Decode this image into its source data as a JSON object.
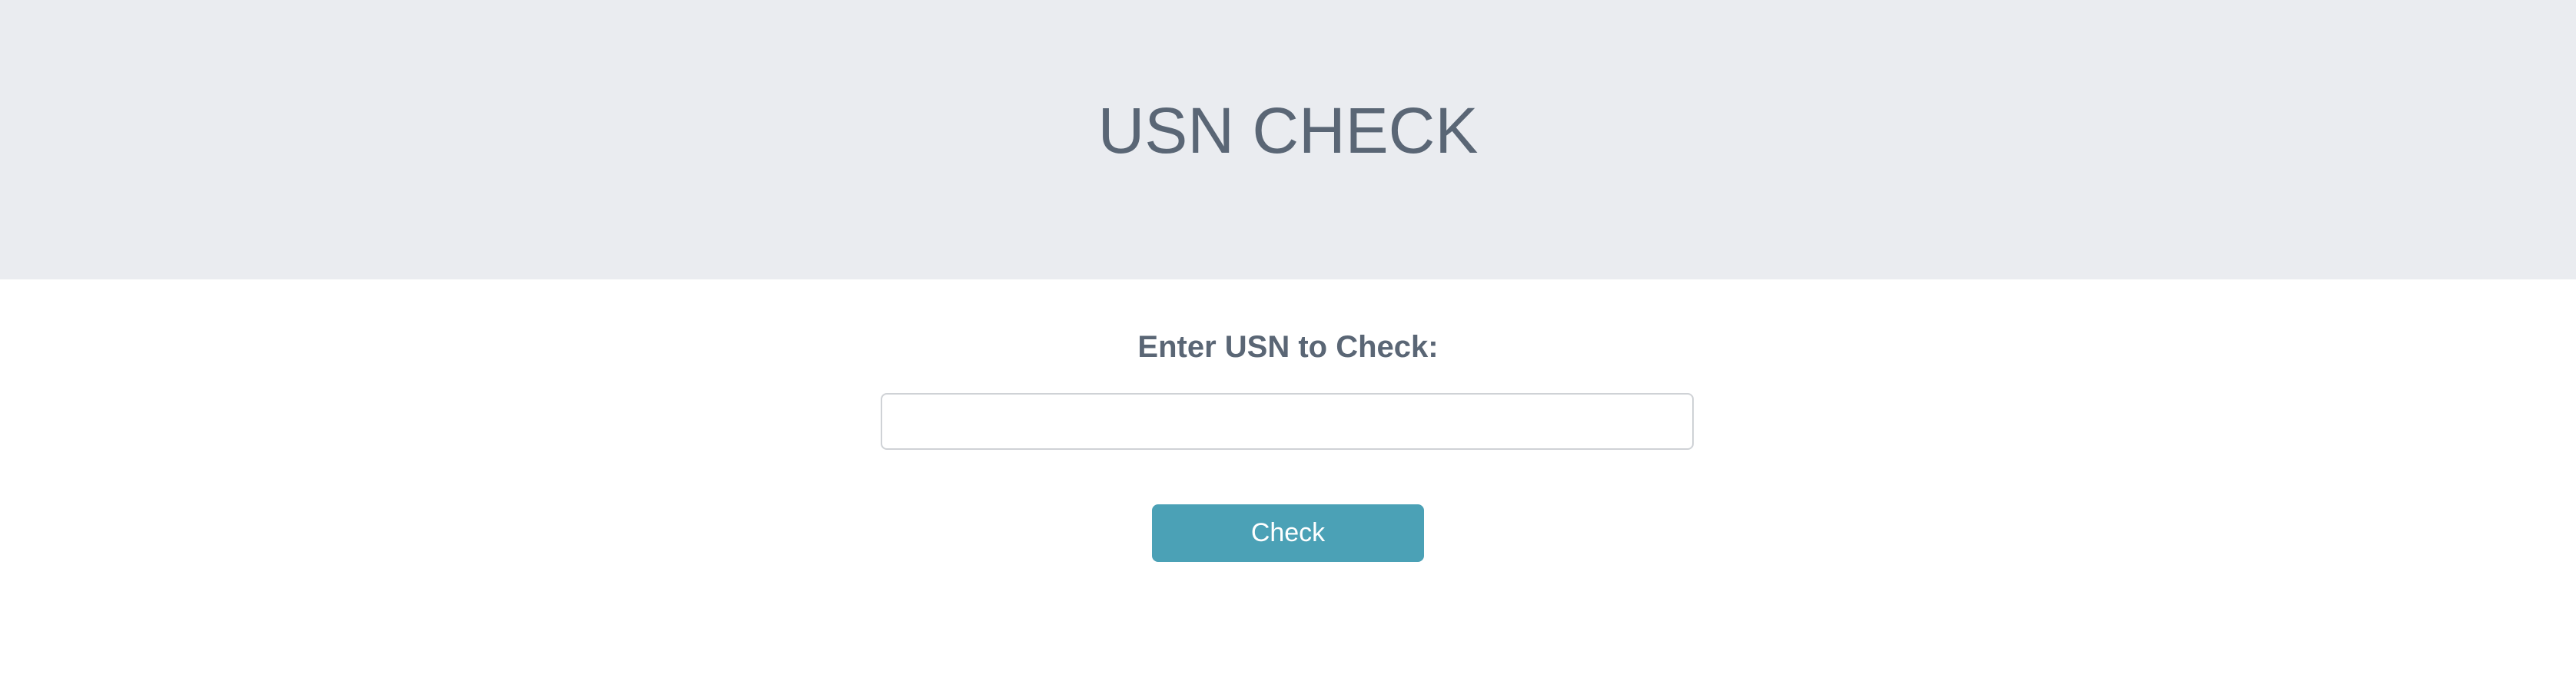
{
  "header": {
    "title": "USN CHECK",
    "background_color": "#eaecf0",
    "title_color": "#5a6675"
  },
  "form": {
    "label": "Enter USN to Check:",
    "usn_input": {
      "value": "",
      "placeholder": ""
    },
    "check_button": {
      "label": "Check",
      "color": "#4ba1b6"
    }
  }
}
